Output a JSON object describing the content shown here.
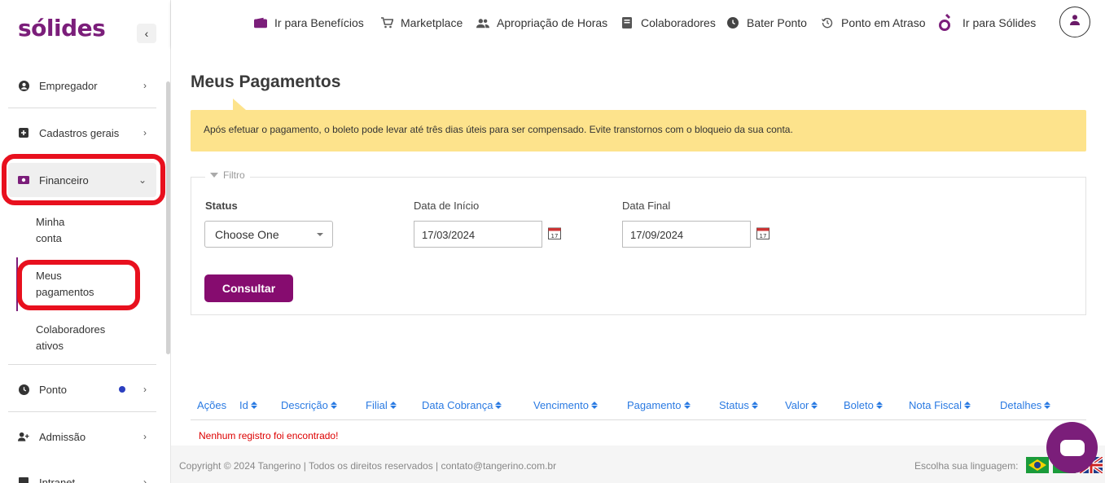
{
  "app": {
    "logo": "sólides"
  },
  "sidebar": {
    "items": [
      {
        "label": "Empregador"
      },
      {
        "label": "Cadastros gerais"
      },
      {
        "label": "Financeiro"
      },
      {
        "label": "Ponto"
      },
      {
        "label": "Admissão"
      },
      {
        "label": "Intranet"
      }
    ],
    "financeiro_sub": [
      {
        "line1": "Minha",
        "line2": "conta"
      },
      {
        "line1": "Meus",
        "line2": "pagamentos"
      },
      {
        "line1": "Colaboradores",
        "line2": "ativos"
      }
    ]
  },
  "topbar": {
    "links": [
      {
        "label": "Ir para Benefícios",
        "icon": "wallet-icon"
      },
      {
        "label": "Marketplace",
        "icon": "cart-icon"
      },
      {
        "label": "Apropriação de Horas",
        "icon": "people-icon"
      },
      {
        "label": "Colaboradores",
        "icon": "book-icon"
      },
      {
        "label": "Bater Ponto",
        "icon": "clock-icon"
      },
      {
        "label": "Ponto em Atraso",
        "icon": "history-icon"
      },
      {
        "label": "Ir para Sólides",
        "icon": "solides-icon"
      }
    ]
  },
  "page": {
    "title": "Meus Pagamentos",
    "alert": "Após efetuar o pagamento, o boleto pode levar até três dias úteis para ser compensado. Evite transtornos com o bloqueio da sua conta."
  },
  "filter": {
    "legend": "Filtro",
    "status_label": "Status",
    "status_value": "Choose One",
    "start_label": "Data de Início",
    "start_value": "17/03/2024",
    "end_label": "Data Final",
    "end_value": "17/09/2024",
    "submit_label": "Consultar"
  },
  "table": {
    "columns": [
      "Ações",
      "Id",
      "Descrição",
      "Filial",
      "Data Cobrança",
      "Vencimento",
      "Pagamento",
      "Status",
      "Valor",
      "Boleto",
      "Nota Fiscal",
      "Detalhes"
    ],
    "empty_message": "Nenhum registro foi encontrado!"
  },
  "footer": {
    "copyright": "Copyright © 2024 Tangerino | Todos os direitos reservados | contato@tangerino.com.br",
    "language_label": "Escolha sua linguagem:"
  },
  "colors": {
    "brand": "#7b1e7a",
    "button": "#860c6f",
    "alert_bg": "#fde38c",
    "link": "#2a7ae2",
    "highlight": "#e8101e"
  }
}
